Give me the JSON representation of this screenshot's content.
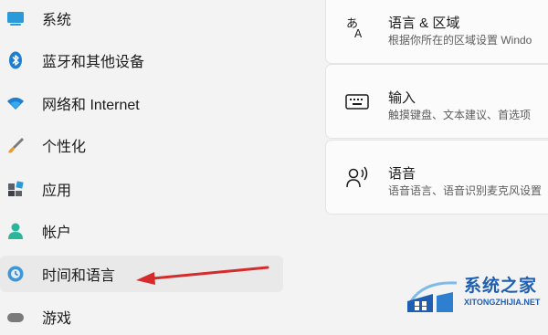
{
  "sidebar": {
    "items": [
      {
        "label": "系统",
        "icon": "monitor-icon"
      },
      {
        "label": "蓝牙和其他设备",
        "icon": "bluetooth-icon"
      },
      {
        "label": "网络和 Internet",
        "icon": "wifi-icon"
      },
      {
        "label": "个性化",
        "icon": "brush-icon"
      },
      {
        "label": "应用",
        "icon": "apps-icon"
      },
      {
        "label": "帐户",
        "icon": "account-icon"
      },
      {
        "label": "时间和语言",
        "icon": "globe-clock-icon",
        "selected": true
      },
      {
        "label": "游戏",
        "icon": "game-icon"
      }
    ]
  },
  "main": {
    "cards": [
      {
        "title": "语言 & 区域",
        "subtitle": "根据你所在的区域设置 Windo",
        "icon": "language-icon"
      },
      {
        "title": "输入",
        "subtitle": "触摸键盘、文本建议、首选项",
        "icon": "keyboard-icon"
      },
      {
        "title": "语音",
        "subtitle": "语音语言、语音识别麦克风设置",
        "icon": "speech-icon"
      }
    ]
  },
  "watermark": {
    "title": "系统之家",
    "url": "XITONGZHIJIA.NET"
  },
  "colors": {
    "background": "#f3f3f3",
    "card": "#fbfbfb",
    "selected": "#e9e9e9",
    "arrow": "#d62b2b",
    "accent": "#1f5fb3"
  }
}
